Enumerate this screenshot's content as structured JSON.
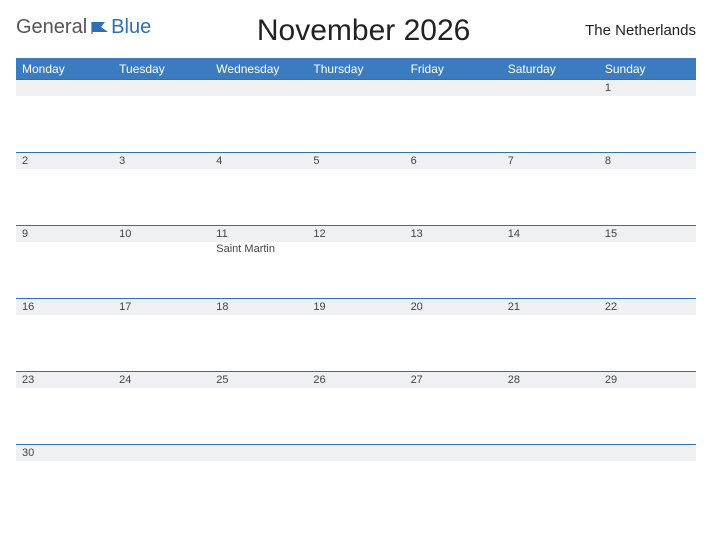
{
  "logo": {
    "general": "General",
    "blue": "Blue"
  },
  "title": "November 2026",
  "country": "The Netherlands",
  "day_headers": [
    "Monday",
    "Tuesday",
    "Wednesday",
    "Thursday",
    "Friday",
    "Saturday",
    "Sunday"
  ],
  "weeks": [
    {
      "dates": [
        "",
        "",
        "",
        "",
        "",
        "",
        "1"
      ],
      "events": [
        "",
        "",
        "",
        "",
        "",
        "",
        ""
      ]
    },
    {
      "dates": [
        "2",
        "3",
        "4",
        "5",
        "6",
        "7",
        "8"
      ],
      "events": [
        "",
        "",
        "",
        "",
        "",
        "",
        ""
      ]
    },
    {
      "dates": [
        "9",
        "10",
        "11",
        "12",
        "13",
        "14",
        "15"
      ],
      "events": [
        "",
        "",
        "Saint Martin",
        "",
        "",
        "",
        ""
      ]
    },
    {
      "dates": [
        "16",
        "17",
        "18",
        "19",
        "20",
        "21",
        "22"
      ],
      "events": [
        "",
        "",
        "",
        "",
        "",
        "",
        ""
      ]
    },
    {
      "dates": [
        "23",
        "24",
        "25",
        "26",
        "27",
        "28",
        "29"
      ],
      "events": [
        "",
        "",
        "",
        "",
        "",
        "",
        ""
      ]
    },
    {
      "dates": [
        "30",
        "",
        "",
        "",
        "",
        "",
        ""
      ],
      "events": [
        "",
        "",
        "",
        "",
        "",
        "",
        ""
      ]
    }
  ]
}
